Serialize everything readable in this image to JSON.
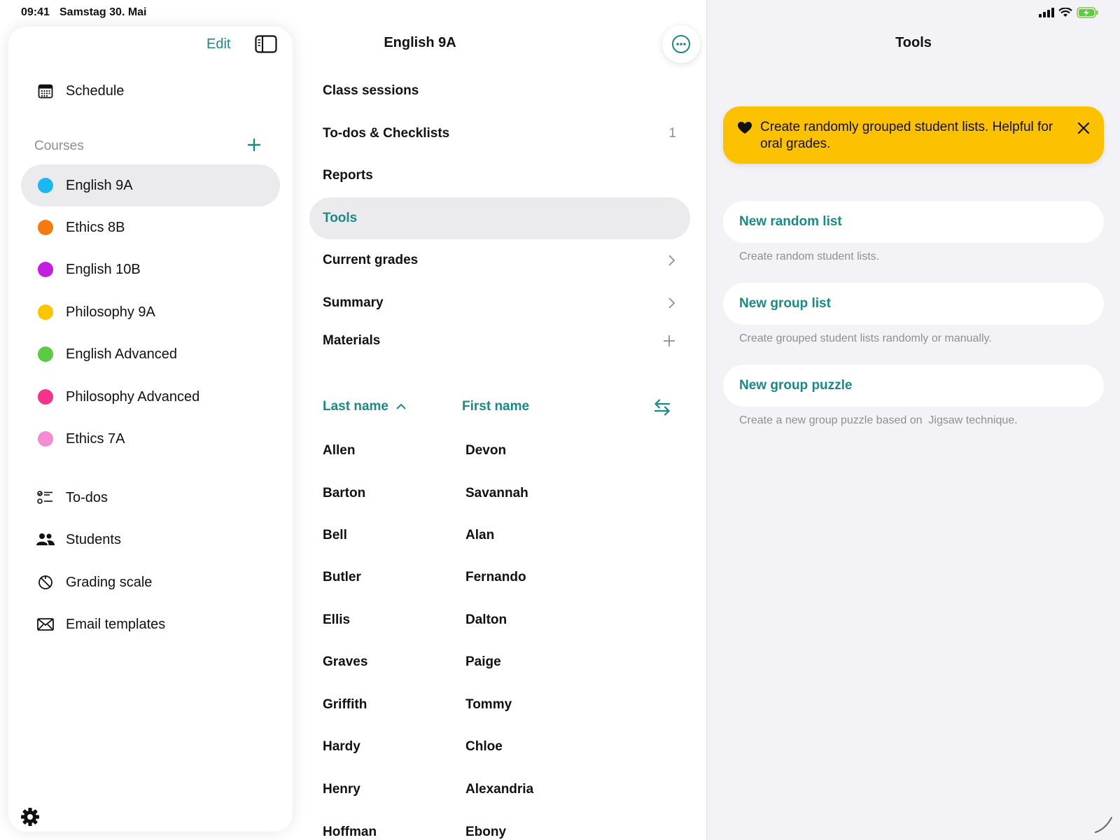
{
  "status": {
    "time": "09:41",
    "date": "Samstag 30. Mai"
  },
  "sidebar": {
    "edit_label": "Edit",
    "schedule_label": "Schedule",
    "courses_header": "Courses",
    "courses": [
      {
        "label": "English 9A",
        "color": "#1ab8f0",
        "active": true
      },
      {
        "label": "Ethics 8B",
        "color": "#f6790f"
      },
      {
        "label": "English 10B",
        "color": "#c41de0"
      },
      {
        "label": "Philosophy 9A",
        "color": "#fcc500"
      },
      {
        "label": "English Advanced",
        "color": "#5acb42"
      },
      {
        "label": "Philosophy Advanced",
        "color": "#f5338a"
      },
      {
        "label": "Ethics 7A",
        "color": "#f58bd0"
      }
    ],
    "tools": [
      {
        "label": "To-dos",
        "icon": "checklist-icon"
      },
      {
        "label": "Students",
        "icon": "people-icon"
      },
      {
        "label": "Grading scale",
        "icon": "grading-scale-icon"
      },
      {
        "label": "Email templates",
        "icon": "envelope-icon"
      }
    ]
  },
  "middle": {
    "title": "English 9A",
    "menu": [
      {
        "label": "Class sessions"
      },
      {
        "label": "To-dos & Checklists",
        "count": "1"
      },
      {
        "label": "Reports"
      },
      {
        "label": "Tools",
        "active": true
      },
      {
        "label": "Current grades"
      },
      {
        "label": "Summary"
      },
      {
        "label": "Materials"
      }
    ],
    "sort": {
      "last_name": "Last name",
      "first_name": "First name"
    },
    "students": [
      {
        "last": "Allen",
        "first": "Devon"
      },
      {
        "last": "Barton",
        "first": "Savannah"
      },
      {
        "last": "Bell",
        "first": "Alan"
      },
      {
        "last": "Butler",
        "first": "Fernando"
      },
      {
        "last": "Ellis",
        "first": "Dalton"
      },
      {
        "last": "Graves",
        "first": "Paige"
      },
      {
        "last": "Griffith",
        "first": "Tommy"
      },
      {
        "last": "Hardy",
        "first": "Chloe"
      },
      {
        "last": "Henry",
        "first": "Alexandria"
      },
      {
        "last": "Hoffman",
        "first": "Ebony"
      }
    ]
  },
  "right": {
    "title": "Tools",
    "banner_text": "Create randomly grouped student lists. Helpful for oral grades.",
    "tools": [
      {
        "label": "New random list",
        "desc": "Create random student lists."
      },
      {
        "label": "New group list",
        "desc": "Create grouped student lists randomly or manually."
      },
      {
        "label": "New group puzzle",
        "desc": "Create a new group puzzle based on  Jigsaw technique."
      }
    ]
  },
  "colors": {
    "accent": "#1a8a85",
    "banner": "#fcc100"
  }
}
